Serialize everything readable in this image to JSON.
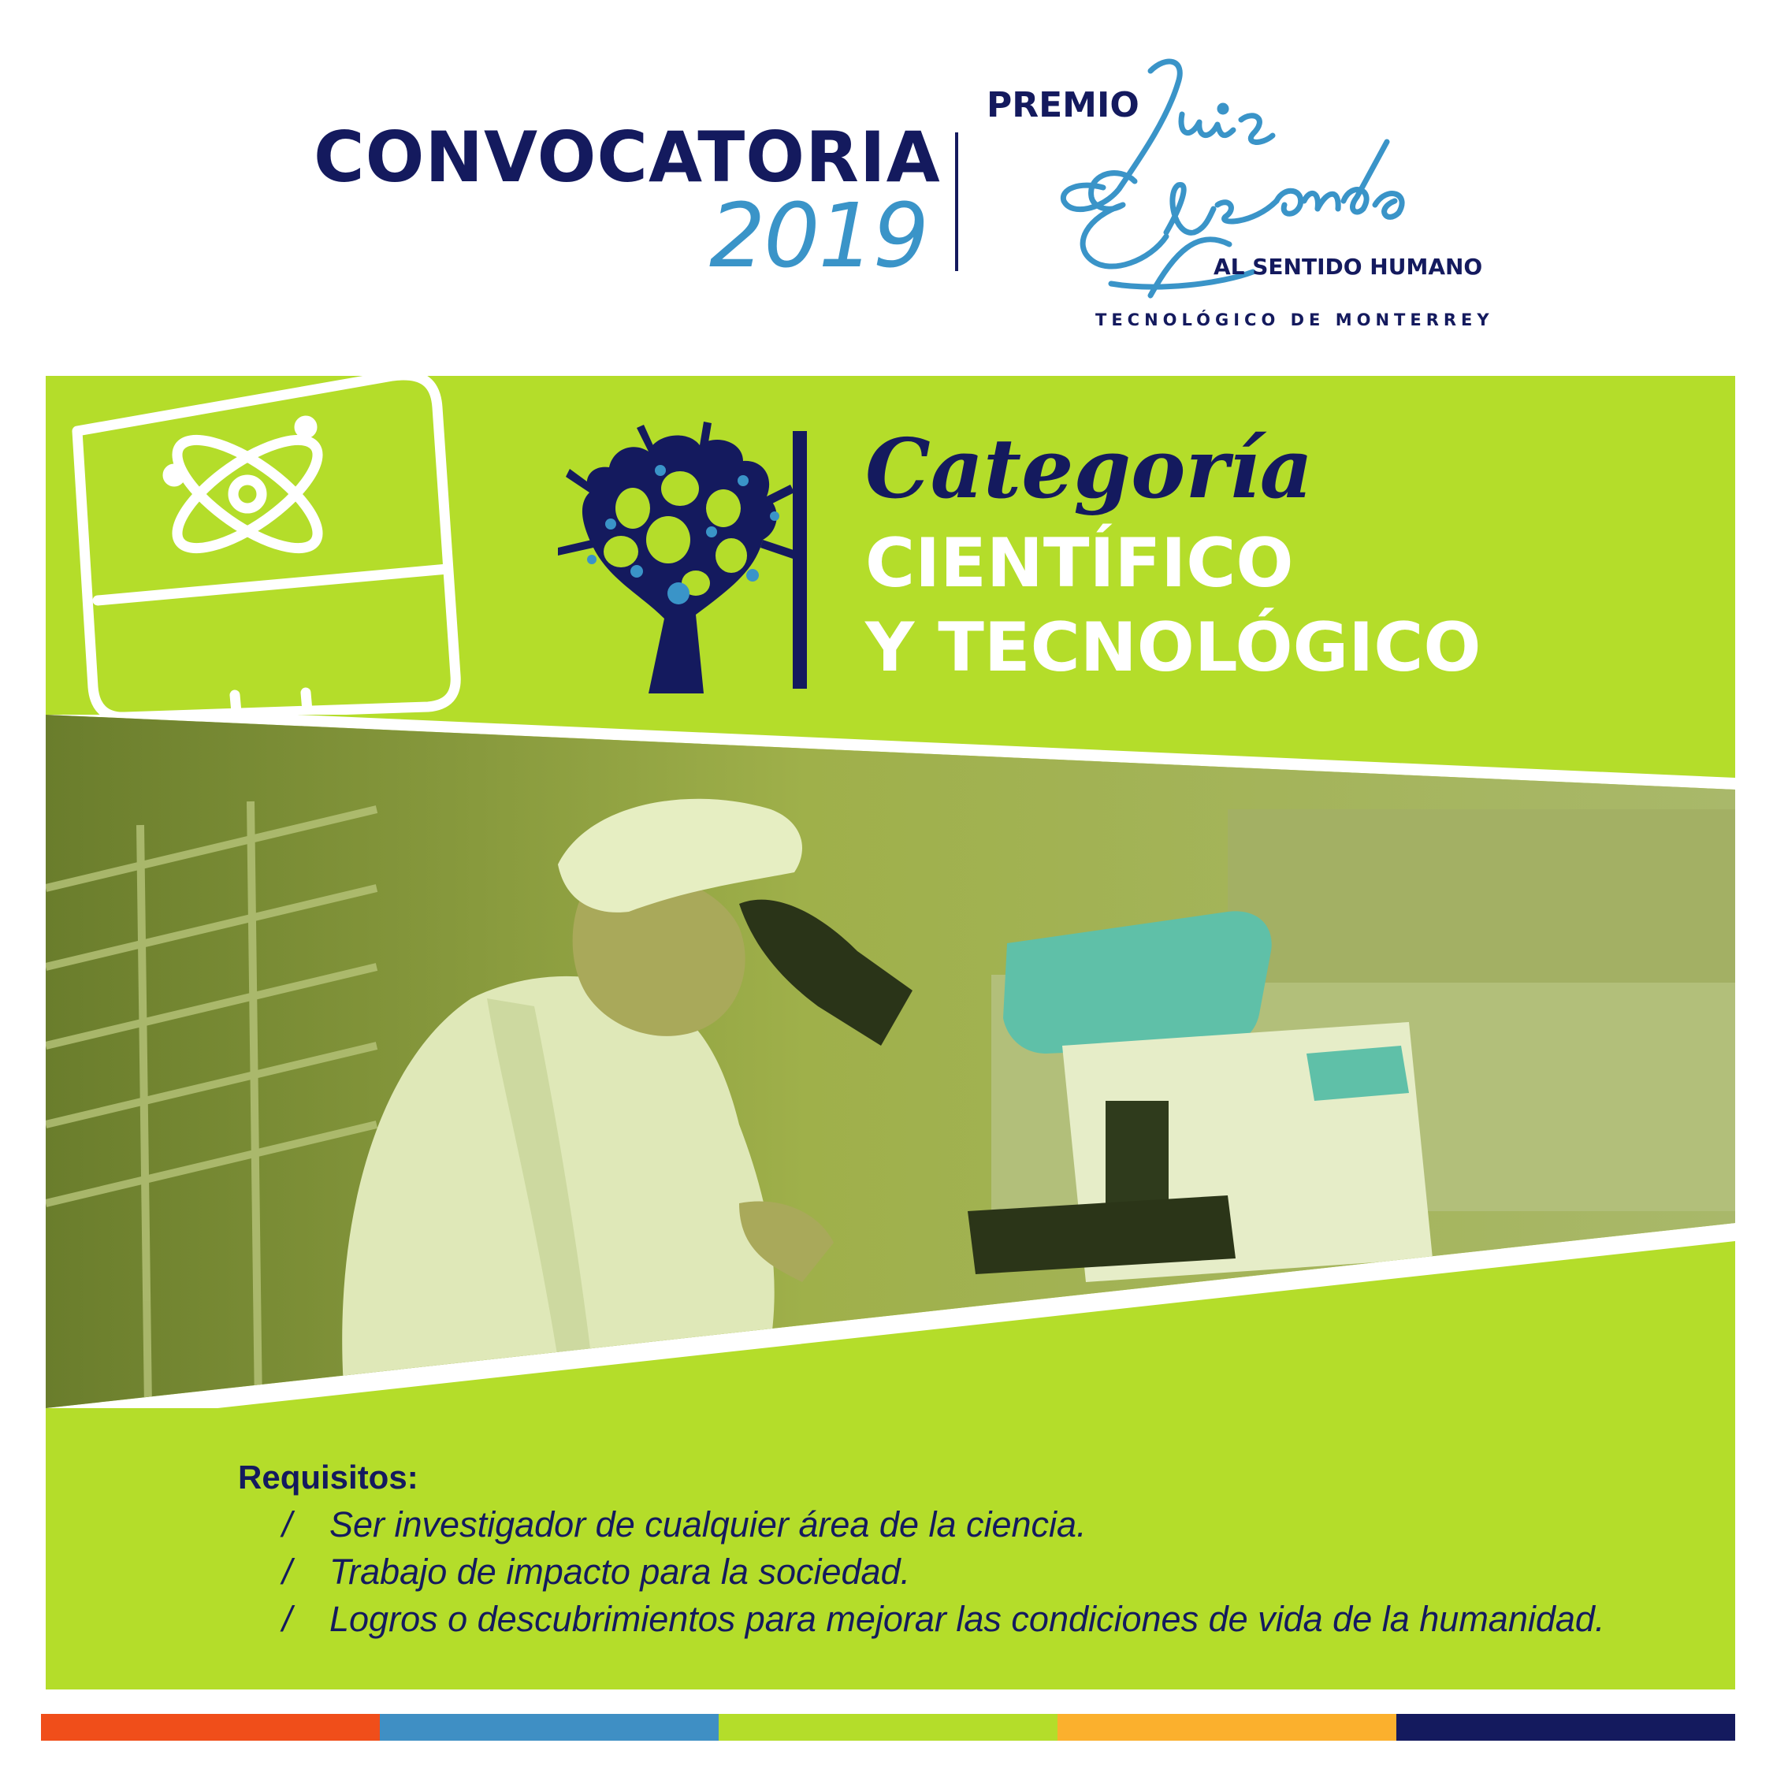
{
  "header": {
    "convocatoria": "CONVOCATORIA",
    "year": "2019",
    "premio": "PREMIO",
    "signature_name": "Luis Elizondo",
    "al_sentido_humano": "AL SENTIDO HUMANO",
    "institution": "TECNOLÓGICO DE MONTERREY"
  },
  "category": {
    "title": "Categoría",
    "subtitle_line1": "CIENTÍFICO",
    "subtitle_line2": "Y TECNOLÓGICO"
  },
  "icons": {
    "monitor": "monitor-atom-icon",
    "tree": "tree-logo-icon"
  },
  "photo": {
    "description_label": "scientist-microscope-photo"
  },
  "requirements": {
    "title": "Requisitos:",
    "bullet": "/",
    "items": [
      "Ser investigador de cualquier área de la ciencia.",
      "Trabajo de impacto para la sociedad.",
      "Logros o descubrimientos para mejorar las condiciones de vida de la humanidad."
    ]
  },
  "colors": {
    "navy": "#141a5e",
    "blue": "#3a94c8",
    "lime": "#b4dd2a",
    "orange": "#f04e1a",
    "mid_blue": "#3f8fc4",
    "amber": "#fbb02d"
  }
}
